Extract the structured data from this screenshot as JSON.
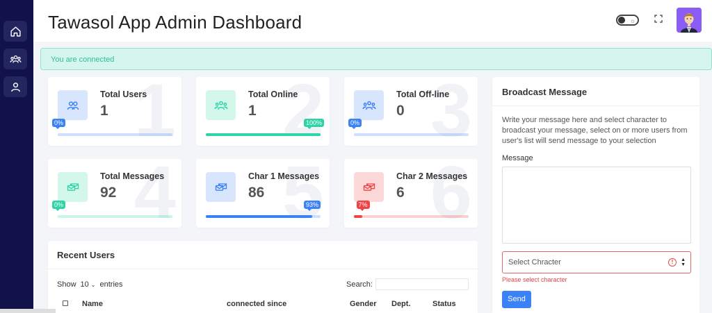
{
  "header": {
    "title": "Tawasol App Admin Dashboard"
  },
  "sidebar": {
    "items": [
      {
        "icon": "home-icon"
      },
      {
        "icon": "users-group-icon"
      },
      {
        "icon": "user-icon"
      }
    ]
  },
  "alert": {
    "text": "You are connected"
  },
  "stats": [
    {
      "label": "Total Users",
      "value": "1",
      "watermark": "1",
      "percent_label": "0%",
      "progress": 0,
      "accent": "#3b82f6",
      "icon": "users-icon"
    },
    {
      "label": "Total Online",
      "value": "1",
      "watermark": "2",
      "percent_label": "100%",
      "progress": 1.0,
      "accent": "#2dd4a7",
      "icon": "users-online-icon"
    },
    {
      "label": "Total Off-line",
      "value": "0",
      "watermark": "3",
      "percent_label": "0%",
      "progress": 0,
      "accent": "#3b82f6",
      "icon": "users-offline-icon"
    },
    {
      "label": "Total Messages",
      "value": "92",
      "watermark": "4",
      "percent_label": "0%",
      "progress": 0,
      "accent": "#2dd4a7",
      "icon": "messages-icon"
    },
    {
      "label": "Char 1 Messages",
      "value": "86",
      "watermark": "5",
      "percent_label": "93%",
      "progress": 0.93,
      "accent": "#3b82f6",
      "icon": "messages-icon"
    },
    {
      "label": "Char 2 Messages",
      "value": "6",
      "watermark": "6",
      "percent_label": "7%",
      "progress": 0.07,
      "accent": "#ef4444",
      "icon": "messages-icon"
    }
  ],
  "recent": {
    "title": "Recent Users",
    "show_label": "Show",
    "entries_value": "10",
    "entries_label": "entries",
    "search_label": "Search:",
    "columns": [
      "Name",
      "connected since",
      "Gender",
      "Dept.",
      "Status"
    ]
  },
  "broadcast": {
    "title": "Broadcast Message",
    "description": "Write your message here and select character to broadcast your message, select on or more users from user's list will send message to your selection",
    "message_label": "Message",
    "select_placeholder": "Select Chracter",
    "error": "Please select character",
    "send_label": "Send"
  },
  "colors": {
    "sidebar": "#11124a",
    "primary": "#3b82f6",
    "success": "#2dd4a7",
    "danger": "#ef4444"
  }
}
